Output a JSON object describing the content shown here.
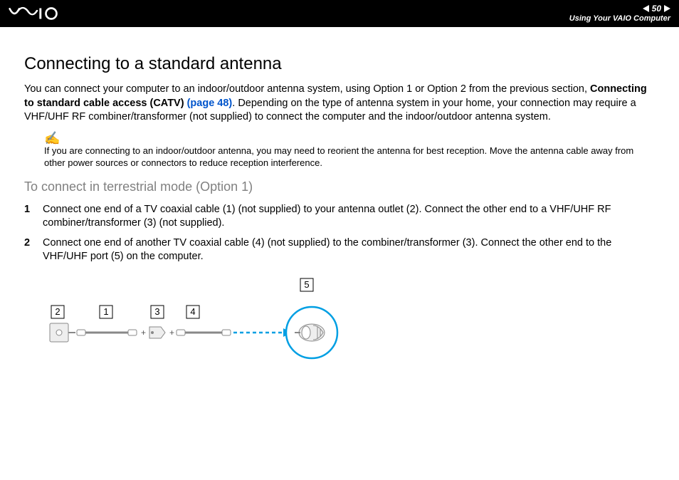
{
  "header": {
    "page_number": "50",
    "section": "Using Your VAIO Computer"
  },
  "body": {
    "title": "Connecting to a standard antenna",
    "intro_pre": "You can connect your computer to an indoor/outdoor antenna system, using Option 1 or Option 2 from the previous section, ",
    "intro_bold": "Connecting to standard cable access (CATV) ",
    "intro_link": "(page 48)",
    "intro_post": ". Depending on the type of antenna system in your home, your connection may require a VHF/UHF RF combiner/transformer (not supplied) to connect the computer and the indoor/outdoor antenna system.",
    "note_icon": "✍",
    "note": "If you are connecting to an indoor/outdoor antenna, you may need to reorient the antenna for best reception. Move the antenna cable away from other power sources or connectors to reduce reception interference.",
    "subheading": "To connect in terrestrial mode (Option 1)",
    "steps": [
      {
        "n": "1",
        "text": "Connect one end of a TV coaxial cable (1) (not supplied) to your antenna outlet (2). Connect the other end to a VHF/UHF RF combiner/transformer (3) (not supplied)."
      },
      {
        "n": "2",
        "text": "Connect one end of another TV coaxial cable (4) (not supplied) to the combiner/transformer (3). Connect the other end to the VHF/UHF port (5) on the computer."
      }
    ],
    "callouts": {
      "c1": "1",
      "c2": "2",
      "c3": "3",
      "c4": "4",
      "c5": "5"
    }
  }
}
